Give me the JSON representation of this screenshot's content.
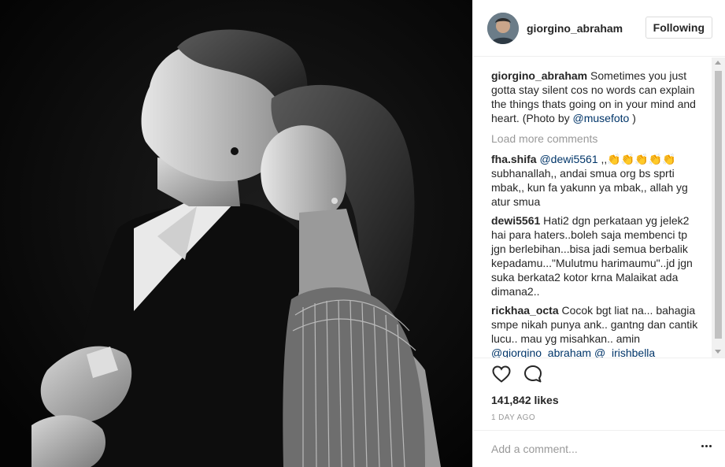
{
  "post": {
    "username": "giorgino_abraham",
    "follow_label": "Following",
    "photo_icon": "photo"
  },
  "caption": {
    "author": "giorgino_abraham",
    "text": "Sometimes you just gotta stay silent cos no words can explain the things thats going on in your mind and heart. (Photo by ",
    "mention": "@musefoto",
    "suffix": " )"
  },
  "load_more_label": "Load more comments",
  "comments": [
    {
      "author": "fha.shifa",
      "mention": "@dewi5561",
      "text": " ,,👏👏👏👏👏 subhanallah,, andai smua org bs sprti mbak,, kun fa yakunn ya mbak,, allah yg atur smua"
    },
    {
      "author": "dewi5561",
      "text": "Hati2 dgn perkataan yg jelek2 hai para haters..boleh saja membenci tp jgn berlebihan...bisa jadi semua berbalik kepadamu...\"Mulutmu harimaumu\"..jd jgn suka berkata2 kotor krna Malaikat ada dimana2.."
    },
    {
      "author": "rickhaa_octa",
      "text": "Cocok bgt liat na... bahagia smpe nikah punya ank.. gantng dan cantik lucu.. mau yg misahkan.. amin ",
      "mention": "@giorgino_abraham @_irishbella"
    }
  ],
  "likes": "141,842 likes",
  "time": "1 DAY AGO",
  "add_comment_placeholder": "Add a comment...",
  "icons": {
    "like": "heart-icon",
    "comment": "comment-bubble-icon",
    "more": "more-options-icon"
  },
  "colors": {
    "mention": "#003569",
    "muted": "#999999",
    "border": "#efefef"
  }
}
